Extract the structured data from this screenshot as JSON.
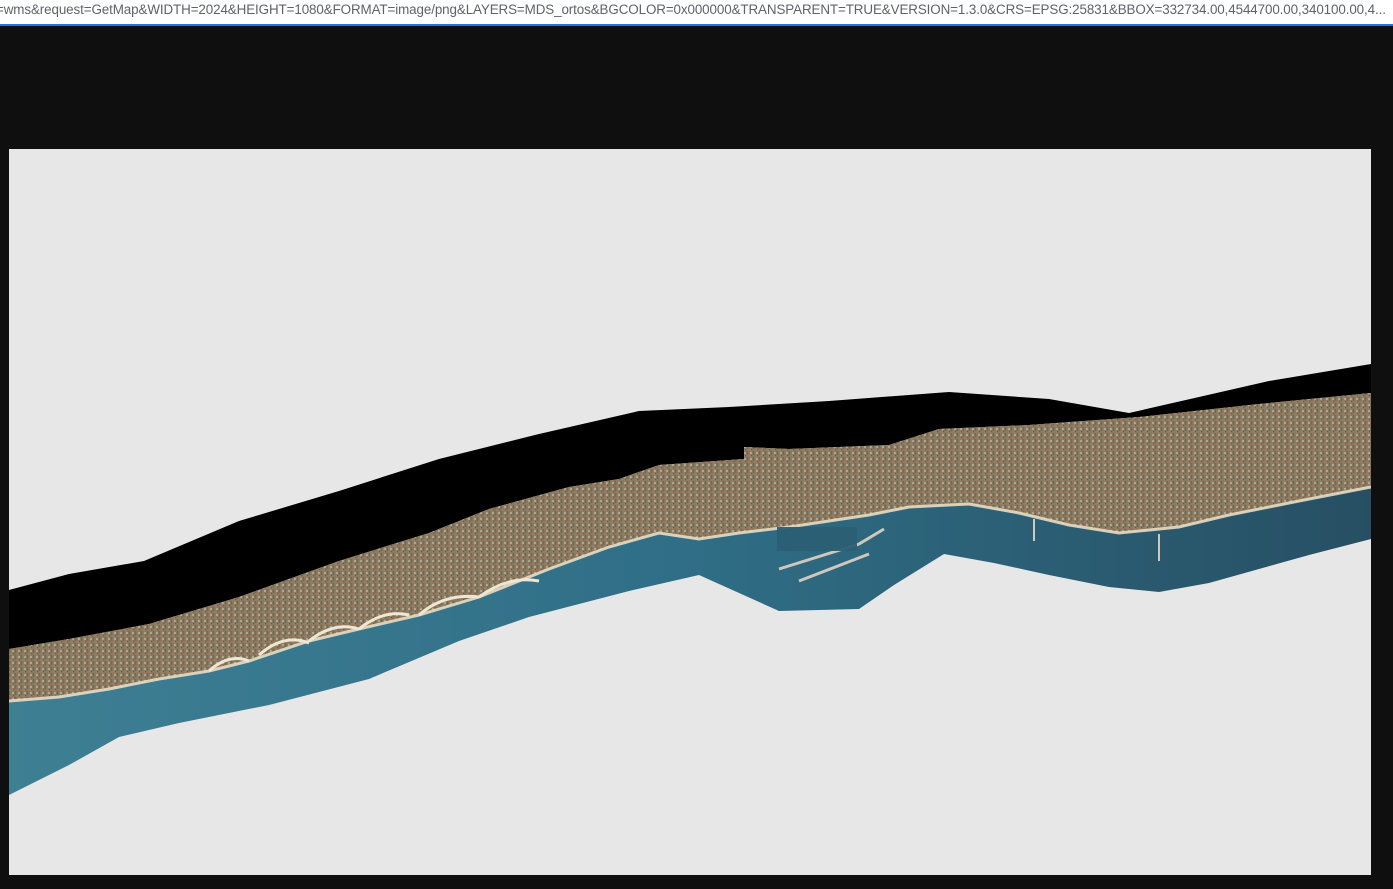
{
  "browser": {
    "address_bar": {
      "url_text": "=wms&request=GetMap&WIDTH=2024&HEIGHT=1080&FORMAT=image/png&LAYERS=MDS_ortos&BGCOLOR=0x000000&TRANSPARENT=TRUE&VERSION=1.3.0&CRS=EPSG:25831&BBOX=332734.00,4544700.00,340100.00,4..."
    }
  },
  "image": {
    "background_color": "#0f0f0f",
    "canvas_color": "#e7e7e7",
    "nodata_color": "#000000",
    "sea_color": "#2f6f86",
    "land_color": "#8b7a62"
  }
}
